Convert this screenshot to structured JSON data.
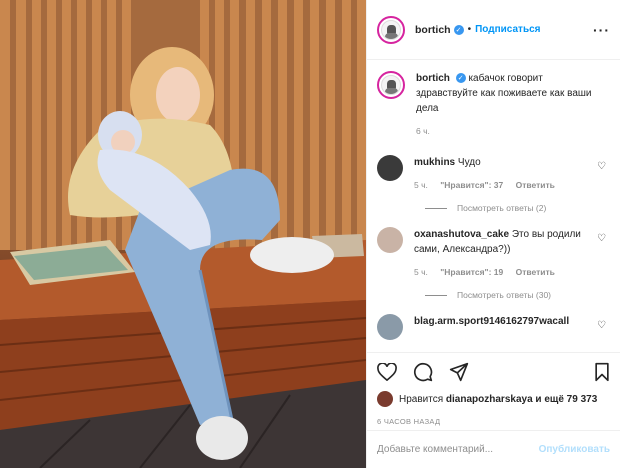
{
  "post": {
    "author": "bortich",
    "follow_label": "Подписаться",
    "more_icon": "more-dots-icon"
  },
  "caption": {
    "username": "bortich",
    "text": "кабачок говорит здравствуйте как поживаете как ваши дела",
    "time": "6 ч."
  },
  "comments": [
    {
      "username": "mukhins",
      "text": "Чудо",
      "time": "5 ч.",
      "likes": "\"Нравится\": 37",
      "reply": "Ответить",
      "view_replies": "Посмотреть ответы (2)"
    },
    {
      "username": "oxanashutova_cake",
      "text": "Это вы родили сами, Александра?))",
      "time": "5 ч.",
      "likes": "\"Нравится\": 19",
      "reply": "Ответить",
      "view_replies": "Посмотреть ответы (30)"
    },
    {
      "username": "blag.arm.sport9146162797wacall",
      "text": ""
    }
  ],
  "likes": {
    "prefix": "Нравится",
    "user": "dianapozharskaya",
    "suffix": "и ещё 79 373"
  },
  "time_ago": "6 ЧАСОВ НАЗАД",
  "add_comment": {
    "placeholder": "Добавьте комментарий...",
    "publish_label": "Опубликовать"
  },
  "colors": {
    "accent": "#0095f6",
    "muted": "#8e8e8e",
    "publish_disabled": "#b2dffc"
  }
}
